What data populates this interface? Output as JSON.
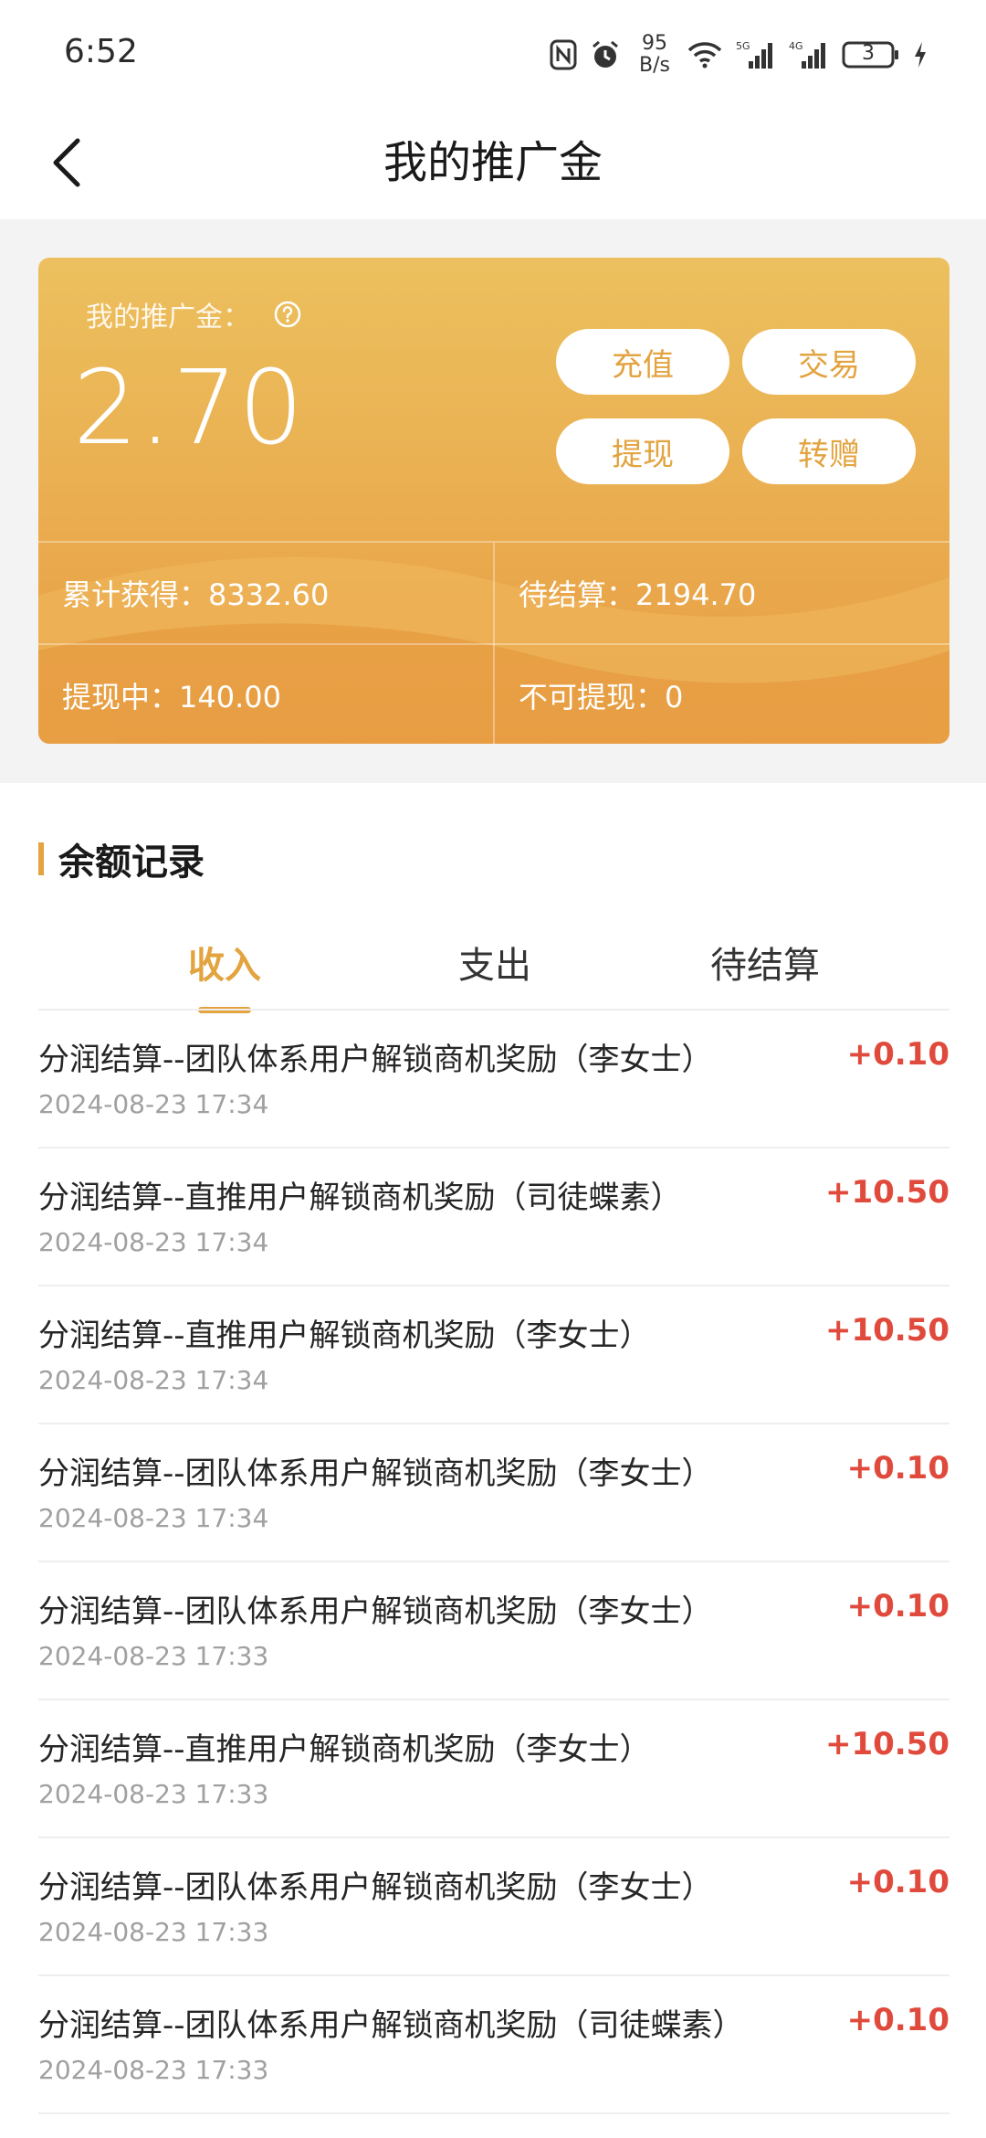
{
  "status_bar": {
    "time": "6:52",
    "net_speed_value": "95",
    "net_speed_unit": "B/s",
    "battery": "3",
    "signal1_label": "5G",
    "signal2_label": "4G"
  },
  "header": {
    "title": "我的推广金"
  },
  "card": {
    "label": "我的推广金：",
    "amount": "2.70",
    "buttons": {
      "recharge": "充值",
      "trade": "交易",
      "withdraw": "提现",
      "transfer": "转赠"
    },
    "stats": {
      "total_earned": "累计获得：8332.60",
      "pending": "待结算：2194.70",
      "withdrawing": "提现中：140.00",
      "not_withdrawable": "不可提现：0"
    }
  },
  "records": {
    "title": "余额记录",
    "tabs": [
      "收入",
      "支出",
      "待结算"
    ],
    "active_tab": "收入",
    "items": [
      {
        "title": "分润结算--团队体系用户解锁商机奖励（李女士）",
        "date": "2024-08-23 17:34",
        "amount": "+0.10"
      },
      {
        "title": "分润结算--直推用户解锁商机奖励（司徒蝶素）",
        "date": "2024-08-23 17:34",
        "amount": "+10.50"
      },
      {
        "title": "分润结算--直推用户解锁商机奖励（李女士）",
        "date": "2024-08-23 17:34",
        "amount": "+10.50"
      },
      {
        "title": "分润结算--团队体系用户解锁商机奖励（李女士）",
        "date": "2024-08-23 17:34",
        "amount": "+0.10"
      },
      {
        "title": "分润结算--团队体系用户解锁商机奖励（李女士）",
        "date": "2024-08-23 17:33",
        "amount": "+0.10"
      },
      {
        "title": "分润结算--直推用户解锁商机奖励（李女士）",
        "date": "2024-08-23 17:33",
        "amount": "+10.50"
      },
      {
        "title": "分润结算--团队体系用户解锁商机奖励（李女士）",
        "date": "2024-08-23 17:33",
        "amount": "+0.10"
      },
      {
        "title": "分润结算--团队体系用户解锁商机奖励（司徒蝶素）",
        "date": "2024-08-23 17:33",
        "amount": "+0.10"
      }
    ]
  },
  "colors": {
    "accent": "#e3a33f",
    "amount_positive": "#e04a3c",
    "card_top": "#ecc05e",
    "card_bottom": "#e8a046"
  },
  "icons": [
    "back-arrow-icon",
    "help-icon",
    "nfc-icon",
    "alarm-icon",
    "wifi-icon",
    "signal-icon",
    "battery-icon",
    "charging-icon"
  ]
}
